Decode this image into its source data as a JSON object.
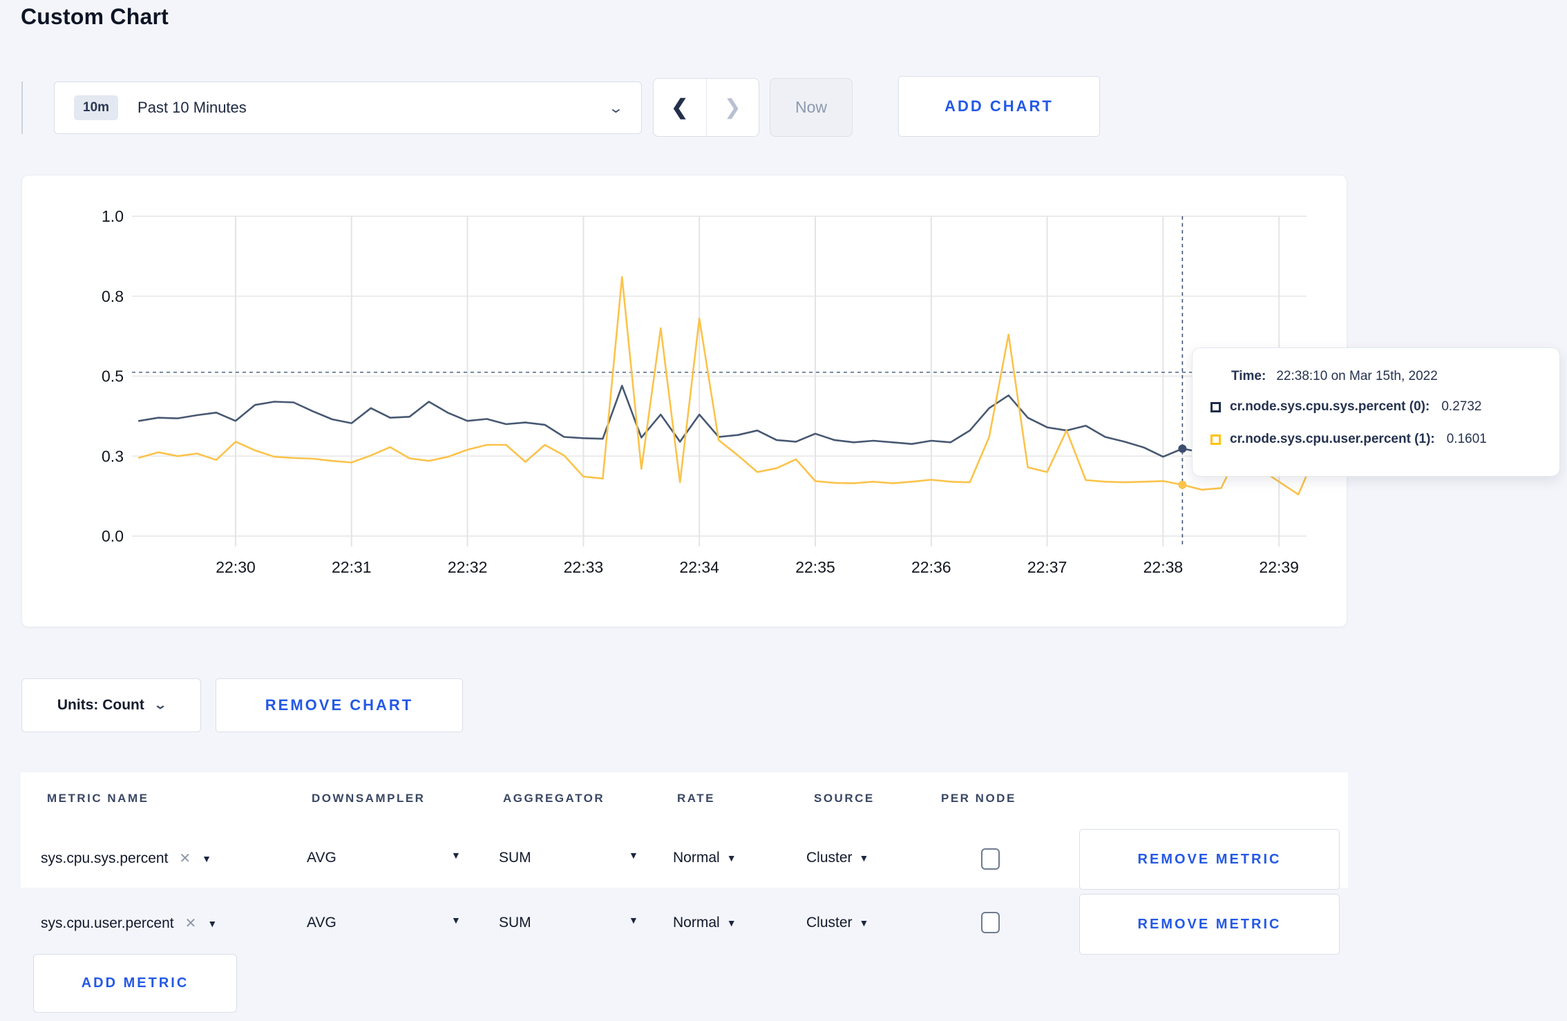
{
  "page": {
    "title": "Custom Chart",
    "background": "#f4f5fa",
    "accent_blue": "#2458e6"
  },
  "toolbar": {
    "range_badge": "10m",
    "range_label": "Past 10 Minutes",
    "prev_icon": "chevron-left",
    "next_icon": "chevron-right",
    "now_label": "Now",
    "add_chart_label": "ADD CHART"
  },
  "chart_data": {
    "type": "line",
    "title": "",
    "xlabel": "",
    "ylabel": "",
    "ylim": [
      0,
      1
    ],
    "grid": true,
    "y_ticks": [
      {
        "label": "0.0",
        "value": 0
      },
      {
        "label": "0.3",
        "value": 0.25
      },
      {
        "label": "0.5",
        "value": 0.5
      },
      {
        "label": "0.8",
        "value": 0.75
      },
      {
        "label": "1.0",
        "value": 1
      }
    ],
    "x_ticks": [
      "22:30",
      "22:31",
      "22:32",
      "22:33",
      "22:34",
      "22:35",
      "22:36",
      "22:37",
      "22:38",
      "22:39"
    ],
    "sample_interval_seconds": 10,
    "first_tick_point_index": 5,
    "points_per_tick": 6,
    "series": [
      {
        "name": "cr.node.sys.cpu.sys.percent (0)",
        "color": "#475872",
        "values": [
          0.36,
          0.37,
          0.368,
          0.378,
          0.386,
          0.36,
          0.41,
          0.42,
          0.418,
          0.39,
          0.365,
          0.353,
          0.4,
          0.37,
          0.373,
          0.42,
          0.385,
          0.36,
          0.366,
          0.35,
          0.355,
          0.348,
          0.31,
          0.306,
          0.304,
          0.47,
          0.308,
          0.38,
          0.295,
          0.38,
          0.31,
          0.316,
          0.33,
          0.3,
          0.295,
          0.32,
          0.3,
          0.293,
          0.298,
          0.293,
          0.288,
          0.298,
          0.293,
          0.33,
          0.4,
          0.44,
          0.37,
          0.34,
          0.33,
          0.345,
          0.31,
          0.295,
          0.277,
          0.248,
          0.2732,
          0.262,
          0.255,
          0.27,
          0.262,
          0.258,
          0.27,
          0.262
        ]
      },
      {
        "name": "cr.node.sys.cpu.user.percent (1)",
        "color": "#fbc34b",
        "values": [
          0.245,
          0.262,
          0.25,
          0.258,
          0.238,
          0.295,
          0.268,
          0.248,
          0.244,
          0.242,
          0.235,
          0.23,
          0.252,
          0.278,
          0.243,
          0.235,
          0.248,
          0.27,
          0.285,
          0.285,
          0.232,
          0.285,
          0.252,
          0.186,
          0.18,
          0.81,
          0.21,
          0.65,
          0.168,
          0.68,
          0.3,
          0.252,
          0.2,
          0.212,
          0.24,
          0.172,
          0.166,
          0.165,
          0.17,
          0.165,
          0.17,
          0.176,
          0.17,
          0.168,
          0.31,
          0.63,
          0.215,
          0.2,
          0.33,
          0.175,
          0.17,
          0.168,
          0.17,
          0.172,
          0.1601,
          0.145,
          0.15,
          0.27,
          0.21,
          0.17,
          0.13,
          0.27
        ]
      }
    ],
    "crosshair": {
      "point_index": 54,
      "time": "22:38:10",
      "hline_value": 0.512,
      "dot_values": [
        0.2732,
        0.1601
      ]
    },
    "legend_position": "tooltip"
  },
  "tooltip": {
    "time_label": "Time:",
    "time_value": "22:38:10 on Mar 15th, 2022",
    "rows": [
      {
        "label": "cr.node.sys.cpu.sys.percent (0):",
        "value": "0.2732",
        "swatch_color": "#1f2c4d"
      },
      {
        "label": "cr.node.sys.cpu.user.percent (1):",
        "value": "0.1601",
        "swatch_color": "#ffc20e"
      }
    ]
  },
  "chart_controls": {
    "units_label": "Units: Count",
    "remove_chart_label": "REMOVE CHART"
  },
  "metrics_table": {
    "headers": [
      "METRIC NAME",
      "DOWNSAMPLER",
      "AGGREGATOR",
      "RATE",
      "SOURCE",
      "PER NODE"
    ],
    "rows": [
      {
        "name": "sys.cpu.sys.percent",
        "downsampler": "AVG",
        "aggregator": "SUM",
        "rate": "Normal",
        "source": "Cluster",
        "per_node_checked": false,
        "remove_label": "REMOVE METRIC"
      },
      {
        "name": "sys.cpu.user.percent",
        "downsampler": "AVG",
        "aggregator": "SUM",
        "rate": "Normal",
        "source": "Cluster",
        "per_node_checked": false,
        "remove_label": "REMOVE METRIC"
      }
    ],
    "add_metric_label": "ADD METRIC"
  }
}
